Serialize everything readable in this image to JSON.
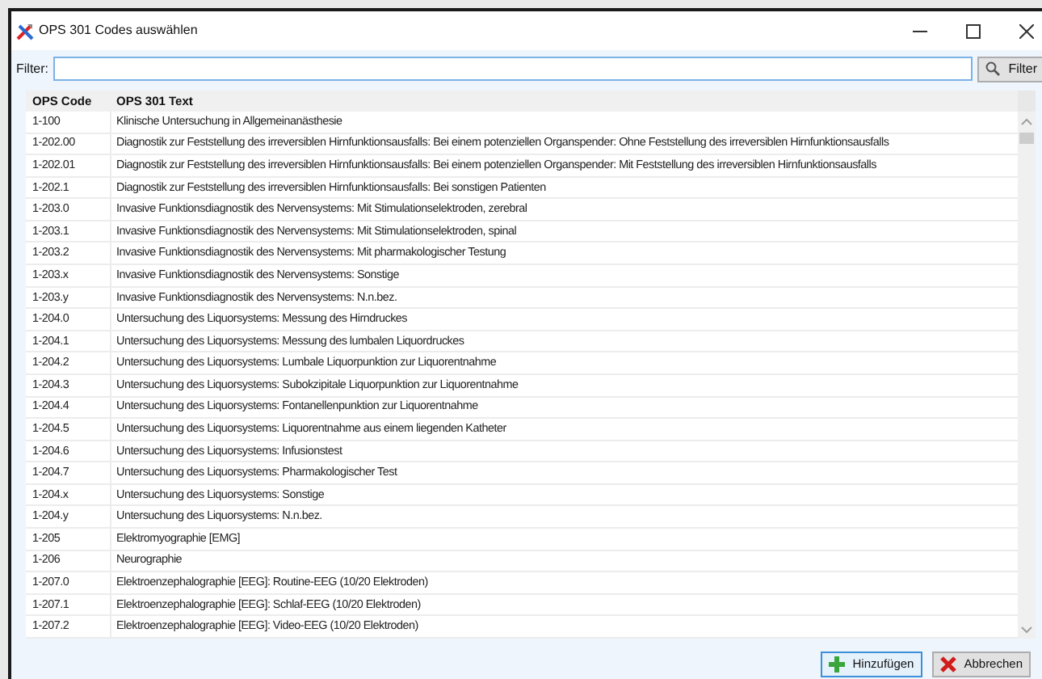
{
  "window": {
    "title": "OPS 301 Codes auswählen"
  },
  "filter": {
    "label": "Filter:",
    "button": "Filter"
  },
  "table": {
    "columns": [
      "OPS Code",
      "OPS 301 Text"
    ],
    "rows": [
      [
        "1-100",
        "Klinische Untersuchung in Allgemeinanästhesie"
      ],
      [
        "1-202.00",
        "Diagnostik zur Feststellung des irreversiblen Hirnfunktionsausfalls: Bei einem potenziellen Organspender: Ohne Feststellung des irreversiblen Hirnfunktionsausfalls"
      ],
      [
        "1-202.01",
        "Diagnostik zur Feststellung des irreversiblen Hirnfunktionsausfalls: Bei einem potenziellen Organspender: Mit Feststellung des irreversiblen Hirnfunktionsausfalls"
      ],
      [
        "1-202.1",
        "Diagnostik zur Feststellung des irreversiblen Hirnfunktionsausfalls: Bei sonstigen Patienten"
      ],
      [
        "1-203.0",
        "Invasive Funktionsdiagnostik des Nervensystems: Mit Stimulationselektroden, zerebral"
      ],
      [
        "1-203.1",
        "Invasive Funktionsdiagnostik des Nervensystems: Mit Stimulationselektroden, spinal"
      ],
      [
        "1-203.2",
        "Invasive Funktionsdiagnostik des Nervensystems: Mit pharmakologischer Testung"
      ],
      [
        "1-203.x",
        "Invasive Funktionsdiagnostik des Nervensystems: Sonstige"
      ],
      [
        "1-203.y",
        "Invasive Funktionsdiagnostik des Nervensystems: N.n.bez."
      ],
      [
        "1-204.0",
        "Untersuchung des Liquorsystems: Messung des Hirndruckes"
      ],
      [
        "1-204.1",
        "Untersuchung des Liquorsystems: Messung des lumbalen Liquordruckes"
      ],
      [
        "1-204.2",
        "Untersuchung des Liquorsystems: Lumbale Liquorpunktion zur Liquorentnahme"
      ],
      [
        "1-204.3",
        "Untersuchung des Liquorsystems: Subokzipitale Liquorpunktion zur Liquorentnahme"
      ],
      [
        "1-204.4",
        "Untersuchung des Liquorsystems: Fontanellenpunktion zur Liquorentnahme"
      ],
      [
        "1-204.5",
        "Untersuchung des Liquorsystems: Liquorentnahme aus einem liegenden Katheter"
      ],
      [
        "1-204.6",
        "Untersuchung des Liquorsystems: Infusionstest"
      ],
      [
        "1-204.7",
        "Untersuchung des Liquorsystems: Pharmakologischer Test"
      ],
      [
        "1-204.x",
        "Untersuchung des Liquorsystems: Sonstige"
      ],
      [
        "1-204.y",
        "Untersuchung des Liquorsystems: N.n.bez."
      ],
      [
        "1-205",
        "Elektromyographie [EMG]"
      ],
      [
        "1-206",
        "Neurographie"
      ],
      [
        "1-207.0",
        "Elektroenzephalographie [EEG]: Routine-EEG (10/20 Elektroden)"
      ],
      [
        "1-207.1",
        "Elektroenzephalographie [EEG]: Schlaf-EEG (10/20 Elektroden)"
      ],
      [
        "1-207.2",
        "Elektroenzephalographie [EEG]: Video-EEG (10/20 Elektroden)"
      ]
    ]
  },
  "buttons": [
    {
      "kind": "add",
      "label": "Hinzufügen"
    },
    {
      "kind": "cancel",
      "label": "Abbrechen"
    }
  ]
}
